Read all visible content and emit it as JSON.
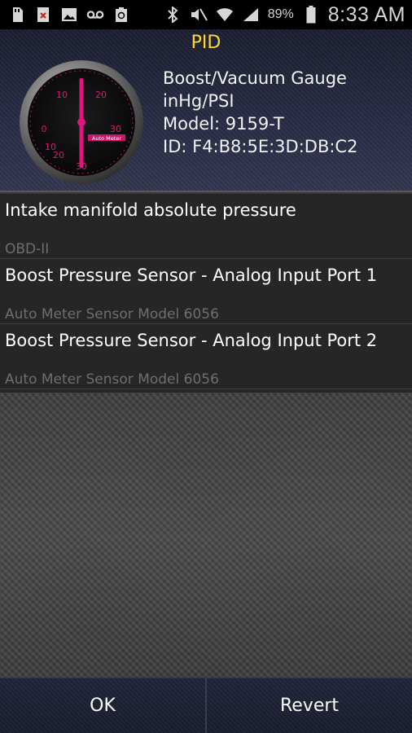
{
  "status_bar": {
    "battery_percent": "89%",
    "time": "8:33 AM",
    "icons": [
      "sd-card-icon",
      "blocked-file-icon",
      "image-icon",
      "voicemail-icon",
      "recycle-icon",
      "bluetooth-icon",
      "mute-icon",
      "wifi-icon",
      "signal-icon",
      "battery-icon"
    ]
  },
  "header": {
    "title": "PID",
    "device": {
      "name": "Boost/Vacuum Gauge",
      "units": "inHg/PSI",
      "model": "Model: 9159-T",
      "id": "ID: F4:B8:5E:3D:DB:C2"
    },
    "gauge": {
      "labels": [
        "10",
        "20",
        "0",
        "30",
        "20",
        "10",
        "30"
      ],
      "accent": "#e0177a",
      "brand": "Auto Meter"
    }
  },
  "pid_list": [
    {
      "name": "Intake manifold absolute pressure",
      "source": "OBD-II"
    },
    {
      "name": "Boost Pressure Sensor - Analog Input Port 1",
      "source": "Auto Meter Sensor Model 6056"
    },
    {
      "name": "Boost Pressure Sensor - Analog Input Port 2",
      "source": "Auto Meter Sensor Model 6056"
    }
  ],
  "buttons": {
    "ok": "OK",
    "revert": "Revert"
  },
  "colors": {
    "title": "#ffd92e",
    "source_text": "#6e6e6e",
    "gauge_accent": "#e0177a"
  }
}
